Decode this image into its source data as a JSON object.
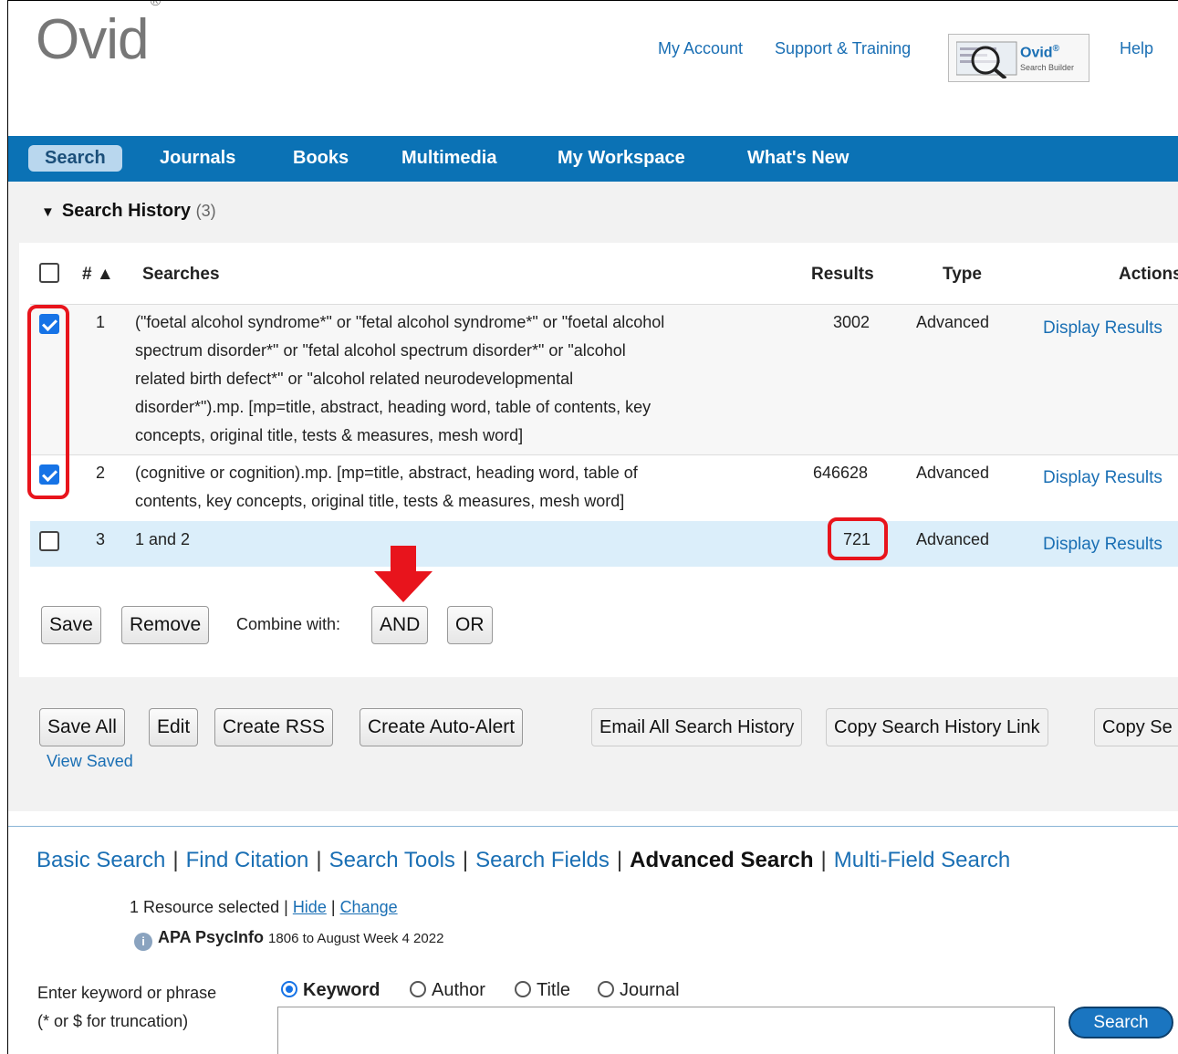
{
  "header": {
    "logo": "Ovid",
    "logo_mark": "®",
    "my_account": "My Account",
    "support": "Support & Training",
    "search_builder_brand": "Ovid",
    "search_builder_mark": "®",
    "search_builder_sub": "Search Builder",
    "help": "Help"
  },
  "nav": {
    "tabs": [
      "Search",
      "Journals",
      "Books",
      "Multimedia",
      "My Workspace",
      "What's New"
    ]
  },
  "search_history": {
    "title": "Search History",
    "count": "(3)",
    "columns": {
      "num": "# ▲",
      "searches": "Searches",
      "results": "Results",
      "type": "Type",
      "actions": "Actions"
    },
    "rows": [
      {
        "num": "1",
        "checked": true,
        "lines": [
          "(\"foetal alcohol syndrome*\" or \"fetal alcohol syndrome*\" or \"foetal alcohol",
          "spectrum disorder*\" or \"fetal alcohol spectrum disorder*\" or \"alcohol",
          "related birth defect*\" or \"alcohol related neurodevelopmental",
          "disorder*\").mp. [mp=title, abstract, heading word, table of contents, key",
          "concepts, original title, tests & measures, mesh word]"
        ],
        "results": "3002",
        "type": "Advanced",
        "action": "Display Results"
      },
      {
        "num": "2",
        "checked": true,
        "lines": [
          "(cognitive or cognition).mp. [mp=title, abstract, heading word, table of",
          "contents, key concepts, original title, tests & measures, mesh word]"
        ],
        "results": "646628",
        "type": "Advanced",
        "action": "Display Results"
      },
      {
        "num": "3",
        "checked": false,
        "lines": [
          "1 and 2"
        ],
        "results": "721",
        "type": "Advanced",
        "action": "Display Results"
      }
    ],
    "save": "Save",
    "remove": "Remove",
    "combine_label": "Combine with:",
    "and": "AND",
    "or": "OR"
  },
  "history_actions": {
    "save_all": "Save All",
    "edit": "Edit",
    "create_rss": "Create RSS",
    "create_auto_alert": "Create Auto-Alert",
    "email_all": "Email All Search History",
    "copy_link": "Copy Search History Link",
    "copy_partial": "Copy Se",
    "view_saved": "View Saved"
  },
  "search_tabs": [
    "Basic Search",
    "Find Citation",
    "Search Tools",
    "Search Fields",
    "Advanced Search",
    "Multi-Field Search"
  ],
  "resource": {
    "selected": "1 Resource selected",
    "hide": "Hide",
    "change": "Change",
    "divider": "|",
    "db_name": "APA PsycInfo",
    "db_range": "1806 to August Week 4 2022"
  },
  "search_form": {
    "label_line1": "Enter keyword or phrase",
    "label_line2": "(* or $ for truncation)",
    "options": [
      "Keyword",
      "Author",
      "Title",
      "Journal"
    ],
    "selected_option": "Keyword",
    "search_button": "Search"
  },
  "colors": {
    "nav_bg": "#0b72b5",
    "link": "#1a6fb4",
    "highlight": "#e8141c",
    "row_selected": "#dbeefa"
  }
}
